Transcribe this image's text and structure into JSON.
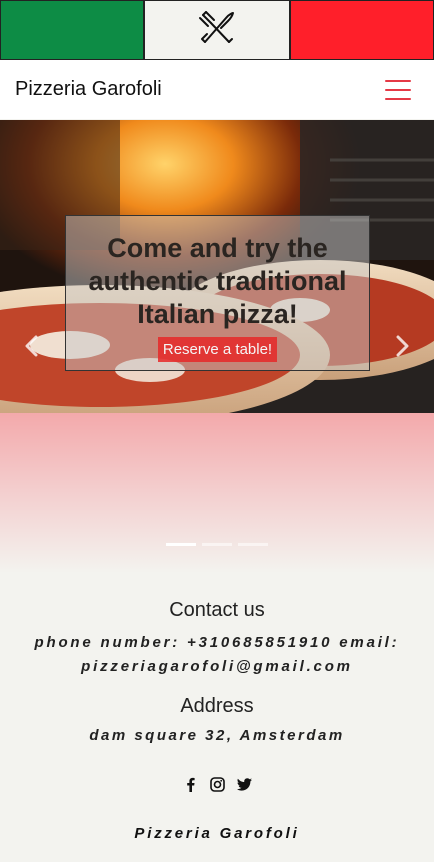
{
  "flag": {
    "colors": {
      "green": "#0d8c45",
      "white": "#f3f3ef",
      "red": "#ff1f2a"
    },
    "center_icon": "crossed-fork-knife-icon"
  },
  "navbar": {
    "brand": "Pizzeria Garofoli",
    "menu_icon": "hamburger-menu-icon",
    "menu_color": "#e53946"
  },
  "hero": {
    "caption": "Come and try the authentic traditional Italian pizza!",
    "button_label": "Reserve a table!",
    "prev_icon": "chevron-left-icon",
    "next_icon": "chevron-right-icon",
    "slides": 3,
    "active_slide": 1
  },
  "footer": {
    "contact_title": "Contact us",
    "contact_text": "phone number: +310685851910 email: pizzeriagarofoli@gmail.com",
    "address_title": "Address",
    "address_text": "dam square 32, Amsterdam",
    "social_icons": [
      "facebook-icon",
      "instagram-icon",
      "twitter-icon"
    ],
    "brand": "Pizzeria Garofoli"
  }
}
